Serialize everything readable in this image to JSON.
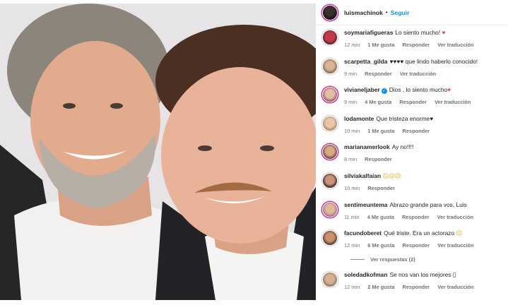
{
  "post": {
    "author": "luismachinok",
    "separator": "•",
    "follow_label": "Seguir"
  },
  "colors": {
    "accent": "#0095f6",
    "heart": "#ed4956",
    "meta": "#737373"
  },
  "comments": [
    {
      "user": "soymariafigueras",
      "text": "Lo siento mucho!",
      "emoji": "♥",
      "emoji_kind": "heart",
      "time": "12 min",
      "likes": "1 Me gusta",
      "reply": "Responder",
      "translate": "Ver traducción"
    },
    {
      "user": "scarpetta_gilda",
      "text": "♥♥♥♥ que lindo haberlo conocido!",
      "time": "9 min",
      "likes": "",
      "reply": "Responder",
      "translate": "Ver traducción"
    },
    {
      "user": "vivianeljaber",
      "verified": true,
      "text": "Dios , lo siento mucho",
      "emoji": "♥",
      "emoji_kind": "heart",
      "time": "9 min",
      "likes": "4 Me gusta",
      "reply": "Responder",
      "translate": "Ver traducción"
    },
    {
      "user": "lodamonte",
      "text": "Que tristeza enorme",
      "emoji": "♥",
      "emoji_kind": "black-heart",
      "time": "10 min",
      "likes": "1 Me gusta",
      "reply": "Responder",
      "translate": ""
    },
    {
      "user": "marianamerlook",
      "text": "Ay no!!!!",
      "time": "8 min",
      "likes": "",
      "reply": "Responder",
      "translate": ""
    },
    {
      "user": "silviakalfaian",
      "text": "",
      "emoji": "☹☹☹",
      "emoji_kind": "sad",
      "time": "10 min",
      "likes": "",
      "reply": "Responder",
      "translate": ""
    },
    {
      "user": "sentimeuntema",
      "text": "Abrazo grande para vos, Luis",
      "time": "11 min",
      "likes": "4 Me gusta",
      "reply": "Responder",
      "translate": "Ver traducción"
    },
    {
      "user": "facundoberet",
      "text": "Qué triste. Era un actorazo",
      "emoji": "☹",
      "emoji_kind": "sad",
      "time": "12 min",
      "likes": "6 Me gusta",
      "reply": "Responder",
      "translate": "Ver traducción",
      "replies_label": "Ver respuestas (2)"
    },
    {
      "user": "soledadkofman",
      "text": "Se nos van los mejores ▯",
      "time": "12 min",
      "likes": "2 Me gusta",
      "reply": "Responder",
      "translate": "Ver traducción"
    }
  ]
}
